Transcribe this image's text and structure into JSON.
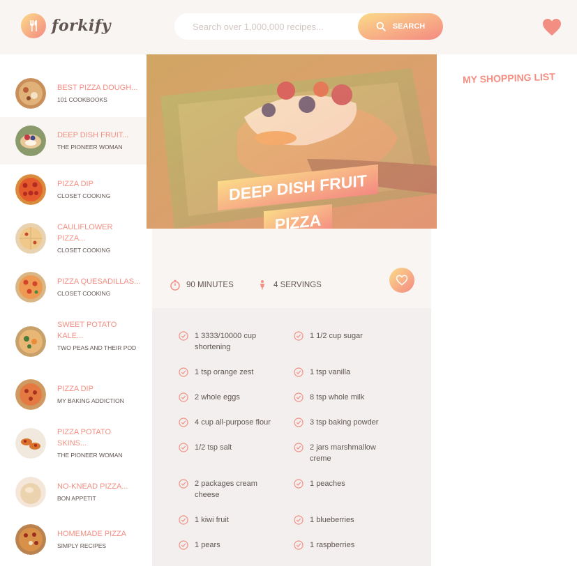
{
  "app": {
    "name": "forkify"
  },
  "search": {
    "placeholder": "Search over 1,000,000 recipes...",
    "button_label": "SEARCH"
  },
  "results": [
    {
      "title": "BEST PIZZA DOUGH...",
      "publisher": "101 COOKBOOKS",
      "active": false
    },
    {
      "title": "DEEP DISH FRUIT...",
      "publisher": "THE PIONEER WOMAN",
      "active": true
    },
    {
      "title": "PIZZA DIP",
      "publisher": "CLOSET COOKING",
      "active": false
    },
    {
      "title": "CAULIFLOWER PIZZA...",
      "publisher": "CLOSET COOKING",
      "active": false
    },
    {
      "title": "PIZZA QUESADILLAS...",
      "publisher": "CLOSET COOKING",
      "active": false
    },
    {
      "title": "SWEET POTATO KALE...",
      "publisher": "TWO PEAS AND THEIR POD",
      "active": false
    },
    {
      "title": "PIZZA DIP",
      "publisher": "MY BAKING ADDICTION",
      "active": false
    },
    {
      "title": "PIZZA POTATO SKINS...",
      "publisher": "THE PIONEER WOMAN",
      "active": false
    },
    {
      "title": "NO-KNEAD PIZZA...",
      "publisher": "BON APPETIT",
      "active": false
    },
    {
      "title": "HOMEMADE PIZZA",
      "publisher": "SIMPLY RECIPES",
      "active": false
    }
  ],
  "recipe": {
    "title_line1": "DEEP DISH FRUIT",
    "title_line2": "PIZZA",
    "time_text": "90 MINUTES",
    "servings_text": "4 SERVINGS",
    "ingredients": [
      {
        "qty": "1 3333/10000",
        "text": "cup shortening"
      },
      {
        "qty": "1 1/2",
        "text": "cup sugar"
      },
      {
        "qty": "1",
        "text": "tsp orange zest"
      },
      {
        "qty": "1",
        "text": "tsp vanilla"
      },
      {
        "qty": "2",
        "text": "whole eggs"
      },
      {
        "qty": "8",
        "text": "tsp whole milk"
      },
      {
        "qty": "4",
        "text": "cup all-purpose flour"
      },
      {
        "qty": "3",
        "text": "tsp baking powder"
      },
      {
        "qty": "1/2",
        "text": "tsp salt"
      },
      {
        "qty": "2",
        "text": "jars marshmallow creme"
      },
      {
        "qty": "2",
        "text": "packages cream cheese"
      },
      {
        "qty": "1",
        "text": "peaches"
      },
      {
        "qty": "1",
        "text": "kiwi fruit"
      },
      {
        "qty": "1",
        "text": "blueberries"
      },
      {
        "qty": "1",
        "text": "pears"
      },
      {
        "qty": "1",
        "text": "raspberries"
      }
    ]
  },
  "shopping": {
    "title": "MY SHOPPING LIST"
  },
  "colors": {
    "accent_start": "#fbdb89",
    "accent_end": "#f48982",
    "text": "#615551",
    "bg_light": "#f9f5f3"
  },
  "icons": {
    "search": "search-icon",
    "heart": "heart-icon",
    "timer": "stopwatch-icon",
    "person": "person-icon",
    "check": "check-circle-icon"
  }
}
